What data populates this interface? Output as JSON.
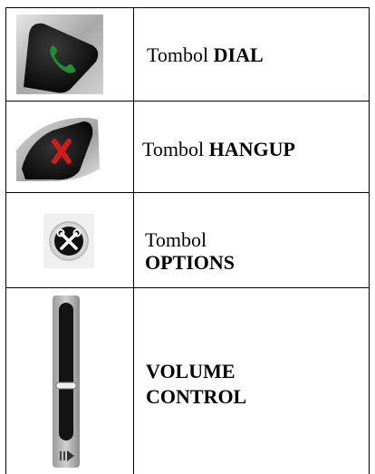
{
  "rows": [
    {
      "icon": "dial-phone-button-icon",
      "text_prefix": "Tombol ",
      "text_bold": "DIAL"
    },
    {
      "icon": "hangup-phone-button-icon",
      "text_prefix": "Tombol ",
      "text_bold": "HANGUP"
    },
    {
      "icon": "options-tools-button-icon",
      "text_prefix": "Tombol",
      "text_bold": "OPTIONS"
    },
    {
      "icon": "volume-slider-icon",
      "text_prefix": "",
      "text_bold_line1": "VOLUME",
      "text_bold_line2": "CONTROL"
    }
  ],
  "colors": {
    "dial_green": "#1f8f2f",
    "hangup_red": "#d41b1b",
    "button_dark": "#1a1a1a",
    "bezel_grey": "#b8b8b8"
  }
}
